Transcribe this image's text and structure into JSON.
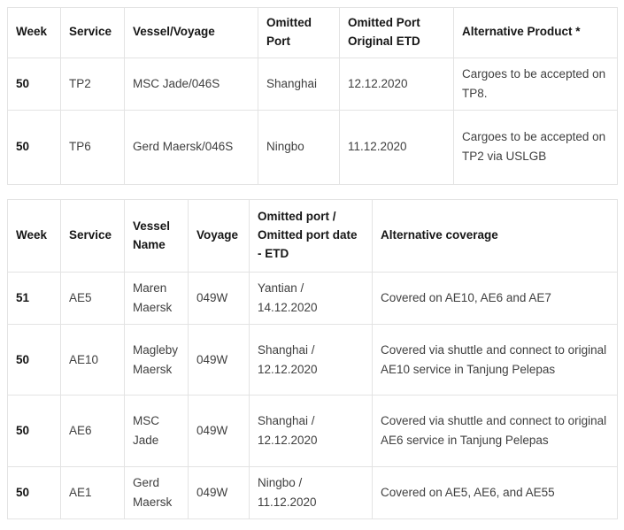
{
  "document": {
    "background_color": "#ffffff",
    "border_color": "#e3e3e3",
    "header_text_color": "#161616",
    "body_text_color": "#3f3f3f"
  },
  "tables": [
    {
      "id": "omitted-port-table-1",
      "columns": [
        "Week",
        "Service",
        "Vessel/Voyage",
        "Omitted Port",
        "Omitted Port Original ETD",
        "Alternative Product *"
      ],
      "rows": [
        {
          "week": "50",
          "service": "TP2",
          "vessel_voyage": "MSC Jade/046S",
          "omitted_port": "Shanghai",
          "omitted_port_original_etd": "12.12.2020",
          "alternative_product": "Cargoes to be accepted on TP8."
        },
        {
          "week": "50",
          "service": "TP6",
          "vessel_voyage": "Gerd Maersk/046S",
          "omitted_port": "Ningbo",
          "omitted_port_original_etd": "11.12.2020",
          "alternative_product": "Cargoes to be accepted on TP2 via USLGB"
        }
      ]
    },
    {
      "id": "omitted-port-table-2",
      "columns": [
        "Week",
        "Service",
        "Vessel Name",
        "Voyage",
        "Omitted port / Omitted port date - ETD",
        "Alternative coverage"
      ],
      "rows": [
        {
          "week": "51",
          "service": "AE5",
          "vessel_name": "Maren Maersk",
          "voyage": "049W",
          "omitted_port_date": "Yantian / 14.12.2020",
          "alternative_coverage": "Covered on AE10, AE6 and AE7"
        },
        {
          "week": "50",
          "service": "AE10",
          "vessel_name": "Magleby Maersk",
          "voyage": "049W",
          "omitted_port_date": "Shanghai / 12.12.2020",
          "alternative_coverage": "Covered via shuttle and connect to original AE10 service in Tanjung Pelepas"
        },
        {
          "week": "50",
          "service": "AE6",
          "vessel_name": "MSC Jade",
          "voyage": "049W",
          "omitted_port_date": "Shanghai / 12.12.2020",
          "alternative_coverage": "Covered via shuttle and connect to original AE6 service in Tanjung Pelepas"
        },
        {
          "week": "50",
          "service": "AE1",
          "vessel_name": "Gerd Maersk",
          "voyage": "049W",
          "omitted_port_date": "Ningbo / 11.12.2020",
          "alternative_coverage": "Covered on AE5, AE6, and AE55"
        }
      ]
    }
  ]
}
